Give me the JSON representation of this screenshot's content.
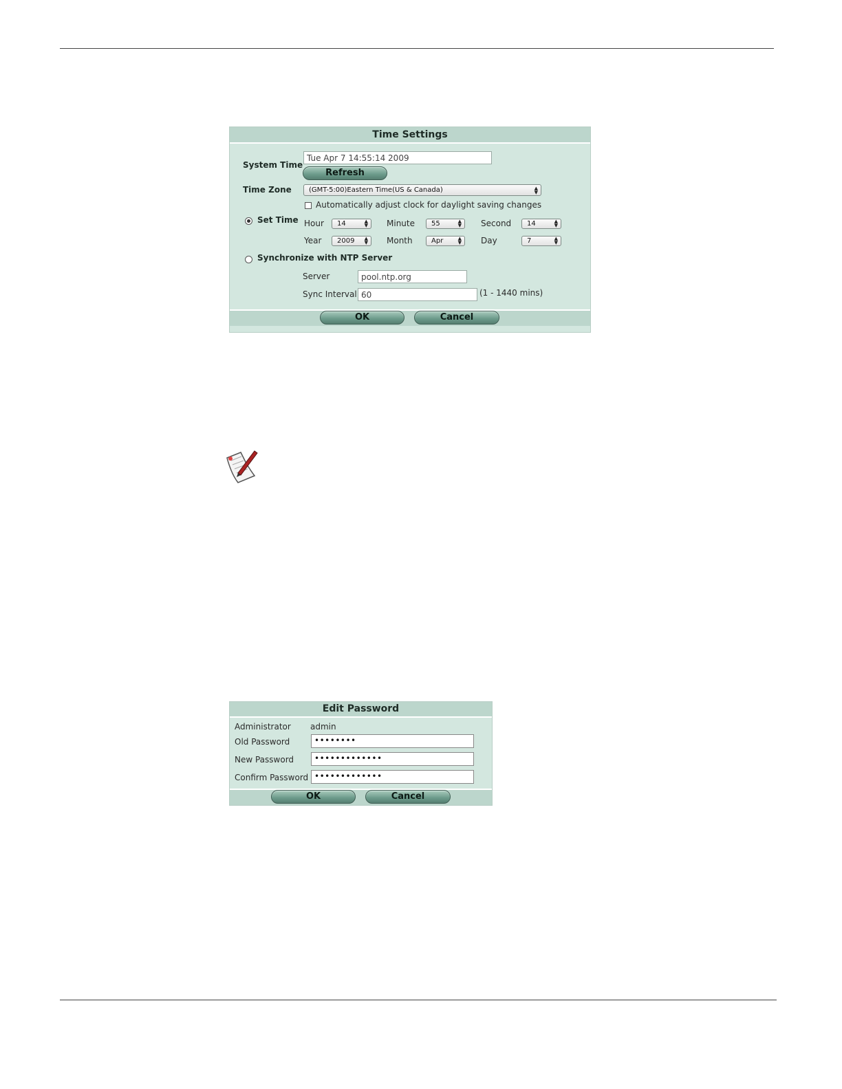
{
  "time_settings": {
    "title": "Time Settings",
    "system_time_label": "System Time",
    "system_time_value": "Tue Apr  7 14:55:14 2009",
    "refresh_label": "Refresh",
    "time_zone_label": "Time Zone",
    "time_zone_value": "(GMT-5:00)Eastern Time(US & Canada)",
    "dst_label": "Automatically adjust clock for daylight saving changes",
    "dst_checked": false,
    "set_time_label": "Set Time",
    "set_time_selected": true,
    "hour_label": "Hour",
    "hour_value": "14",
    "minute_label": "Minute",
    "minute_value": "55",
    "second_label": "Second",
    "second_value": "14",
    "year_label": "Year",
    "year_value": "2009",
    "month_label": "Month",
    "month_value": "Apr",
    "day_label": "Day",
    "day_value": "7",
    "ntp_label": "Synchronize with NTP Server",
    "ntp_selected": false,
    "server_label": "Server",
    "server_value": "pool.ntp.org",
    "sync_interval_label": "Sync Interval",
    "sync_interval_value": "60",
    "sync_interval_hint": "(1 - 1440 mins)",
    "ok_label": "OK",
    "cancel_label": "Cancel"
  },
  "note_icon": "note-pencil-icon",
  "edit_password": {
    "title": "Edit Password",
    "administrator_label": "Administrator",
    "administrator_value": "admin",
    "old_password_label": "Old Password",
    "old_password_value": "••••••••",
    "new_password_label": "New Password",
    "new_password_value": "•••••••••••••",
    "confirm_password_label": "Confirm Password",
    "confirm_password_value": "•••••••••••••",
    "ok_label": "OK",
    "cancel_label": "Cancel"
  },
  "colors": {
    "panel_bg": "#d3e7df",
    "panel_header": "#bcd6cc",
    "button": "#6b9a8a"
  }
}
